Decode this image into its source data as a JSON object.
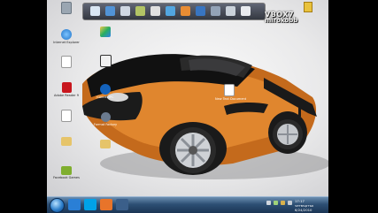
{
  "desktop": {
    "brand": {
      "line1": "VBOX7",
      "line2": "mirokobb"
    },
    "icons": [
      {
        "id": "recycle",
        "label": "",
        "color": "#9aa6b2"
      },
      {
        "id": "ie",
        "label": "Internet Explorer",
        "color": "#1e73c8"
      },
      {
        "id": "file1",
        "label": "",
        "color": "#ffffff"
      },
      {
        "id": "pdf",
        "label": "Adobe Reader 9",
        "color": "#c8171e"
      },
      {
        "id": "file2",
        "label": "",
        "color": "#ffffff"
      },
      {
        "id": "folder",
        "label": "",
        "color": "#e6c46a"
      },
      {
        "id": "skype",
        "label": "Skype",
        "color": "#00a2e8"
      },
      {
        "id": "green",
        "label": "Facebook Games",
        "color": "#7fae2e"
      },
      {
        "id": "cs",
        "label": "",
        "color": "#2a2a2a"
      },
      {
        "id": "teamviewer",
        "label": "ConnectPC",
        "color": "#1463bd"
      },
      {
        "id": "format",
        "label": "Format Factory",
        "color": "#6b7b8f"
      },
      {
        "id": "folder2",
        "label": "",
        "color": "#e6c46a"
      },
      {
        "id": "textdoc",
        "label": "New Text Document",
        "color": "#ffffff"
      }
    ]
  },
  "dock": {
    "items": [
      {
        "name": "dock-app",
        "color": "#d9e7f5"
      },
      {
        "name": "dock-app",
        "color": "#4a8fd6"
      },
      {
        "name": "dock-app",
        "color": "#cfd8e3"
      },
      {
        "name": "dock-app",
        "color": "#b0c35e"
      },
      {
        "name": "dock-app",
        "color": "#e0e0e0"
      },
      {
        "name": "dock-app",
        "color": "#4aa3e0"
      },
      {
        "name": "dock-app",
        "color": "#e8882a"
      },
      {
        "name": "dock-app",
        "color": "#2f6fbf"
      },
      {
        "name": "dock-app",
        "color": "#8fa0b5"
      },
      {
        "name": "dock-app",
        "color": "#c9d1da"
      },
      {
        "name": "dock-app",
        "color": "#e9ecf0"
      }
    ]
  },
  "taskbar": {
    "buttons": [
      {
        "name": "ie-taskbar-button",
        "color": "#2a7fd6"
      },
      {
        "name": "skype-taskbar-button",
        "color": "#00a2e8"
      },
      {
        "name": "firefox-taskbar-button",
        "color": "#e8742a"
      },
      {
        "name": "window-taskbar-button",
        "color": "#3b5f8a"
      }
    ],
    "clock": {
      "time": "17:17",
      "day": "четвъртък",
      "date": "6/24/2010"
    }
  }
}
